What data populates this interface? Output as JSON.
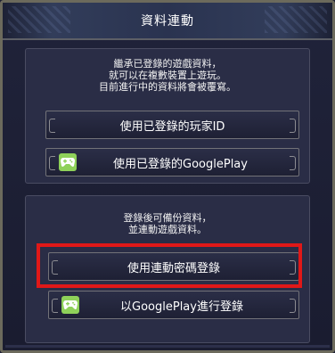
{
  "dialog": {
    "title": "資料連動"
  },
  "inherit_panel": {
    "desc_lines": [
      "繼承已登錄的遊戲資料，",
      "就可以在複數裝置上遊玩。",
      "目前進行中的資料將會被覆寫。"
    ],
    "buttons": {
      "player_id": "使用已登錄的玩家ID",
      "googleplay": "使用已登錄的GooglePlay"
    }
  },
  "register_panel": {
    "desc_lines": [
      "登錄後可備份資料，",
      "並連動遊戲資料。"
    ],
    "buttons": {
      "password": "使用連動密碼登錄",
      "googleplay": "以GooglePlay進行登錄"
    }
  },
  "colors": {
    "highlight": "#e01818",
    "googleplay_icon": "#8fd15a"
  },
  "icons": {
    "googleplay": "gamepad-icon"
  }
}
